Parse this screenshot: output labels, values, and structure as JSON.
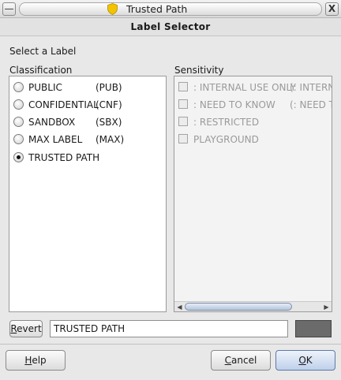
{
  "window": {
    "title": "Trusted Path",
    "menu_icon": "window-menu-icon",
    "close_glyph": "X"
  },
  "header": {
    "title": "Label Selector"
  },
  "prompt": "Select a Label",
  "classification": {
    "heading": "Classification",
    "items": [
      {
        "name": "PUBLIC",
        "code": "(PUB)",
        "selected": false
      },
      {
        "name": "CONFIDENTIAL",
        "code": "(CNF)",
        "selected": false
      },
      {
        "name": "SANDBOX",
        "code": "(SBX)",
        "selected": false
      },
      {
        "name": "MAX LABEL",
        "code": "(MAX)",
        "selected": false
      },
      {
        "name": "TRUSTED PATH",
        "code": "",
        "selected": true
      }
    ]
  },
  "sensitivity": {
    "heading": "Sensitivity",
    "items": [
      {
        "name": ": INTERNAL USE ONLY",
        "code": "(: INTERNA",
        "checked": false,
        "enabled": false
      },
      {
        "name": ": NEED TO KNOW",
        "code": "(: NEED TO",
        "checked": false,
        "enabled": false
      },
      {
        "name": ": RESTRICTED",
        "code": "",
        "checked": false,
        "enabled": false
      },
      {
        "name": "PLAYGROUND",
        "code": "",
        "checked": false,
        "enabled": false
      }
    ],
    "scrollbar": {
      "left_arrow": "◀",
      "right_arrow": "▶"
    }
  },
  "label_field": {
    "value": "TRUSTED PATH"
  },
  "color_swatch": {
    "color": "#6b6b6b"
  },
  "buttons": {
    "revert": {
      "mnemonic": "R",
      "rest": "evert"
    },
    "help": {
      "mnemonic": "H",
      "rest": "elp"
    },
    "cancel": {
      "mnemonic": "C",
      "rest": "ancel"
    },
    "ok": {
      "mnemonic": "O",
      "rest": "K"
    }
  },
  "colors": {
    "accent": "#bfd0ea",
    "title_bar": "#dcdcdc",
    "shield": "#f2c400"
  }
}
